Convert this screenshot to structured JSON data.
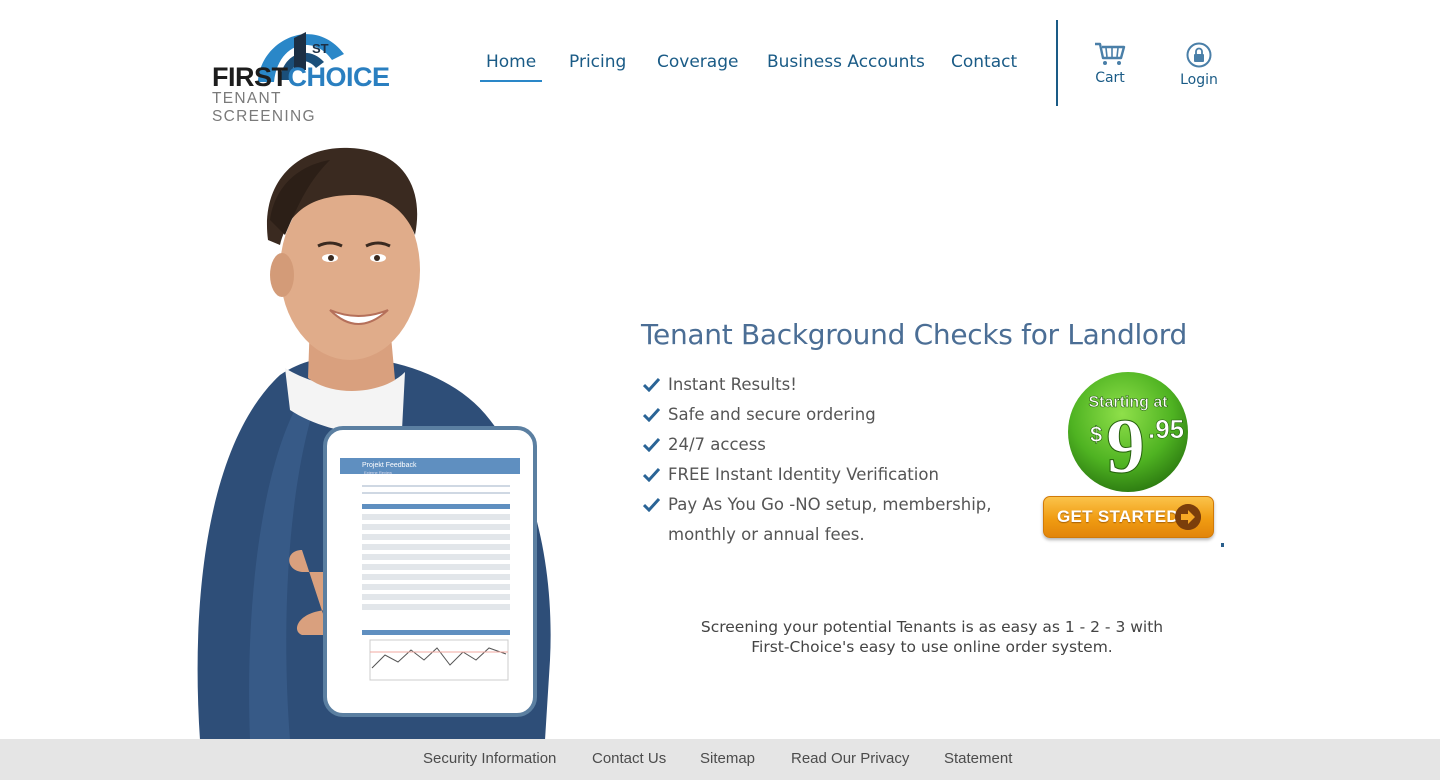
{
  "logo": {
    "word_first": "FIRST",
    "word_choice": "CHOICE",
    "sub": "TENANT SCREENING",
    "emblem_text": "ST"
  },
  "nav": {
    "items": [
      {
        "label": "Home",
        "active": true
      },
      {
        "label": "Pricing"
      },
      {
        "label": "Coverage"
      },
      {
        "label": "Business Accounts"
      },
      {
        "label": "Contact"
      }
    ]
  },
  "tools": {
    "cart": {
      "label": "Cart",
      "icon": "cart-icon"
    },
    "login": {
      "label": "Login",
      "icon": "lock-icon"
    }
  },
  "hero": {
    "tablet_title": "Projekt Feedback",
    "tablet_subtitle": "Externe Review"
  },
  "main": {
    "headline": "Tenant Background Checks for Landlord",
    "features": [
      "Instant Results!",
      "Safe and secure ordering",
      "24/7 access",
      "FREE Instant Identity Verification",
      "Pay As You Go -NO setup, membership, monthly or annual fees."
    ],
    "badge": {
      "top": "Starting at",
      "dollar": "$",
      "big": "9",
      "cents": ".95"
    },
    "cta_label": "GET STARTED",
    "tagline_line1": "Screening your potential Tenants is as easy as 1 - 2 - 3 with",
    "tagline_line2": "First-Choice's easy to use online order system."
  },
  "footer": {
    "links": [
      "Security Information",
      "Contact Us",
      "Sitemap",
      "Read Our Privacy",
      "Statement"
    ]
  },
  "colors": {
    "nav": "#1a5b86",
    "headline": "#4b6e95",
    "check": "#2a6496",
    "cta": "#f09c12",
    "badge": "#5cb82a",
    "footer_bg": "#e5e5e5"
  }
}
